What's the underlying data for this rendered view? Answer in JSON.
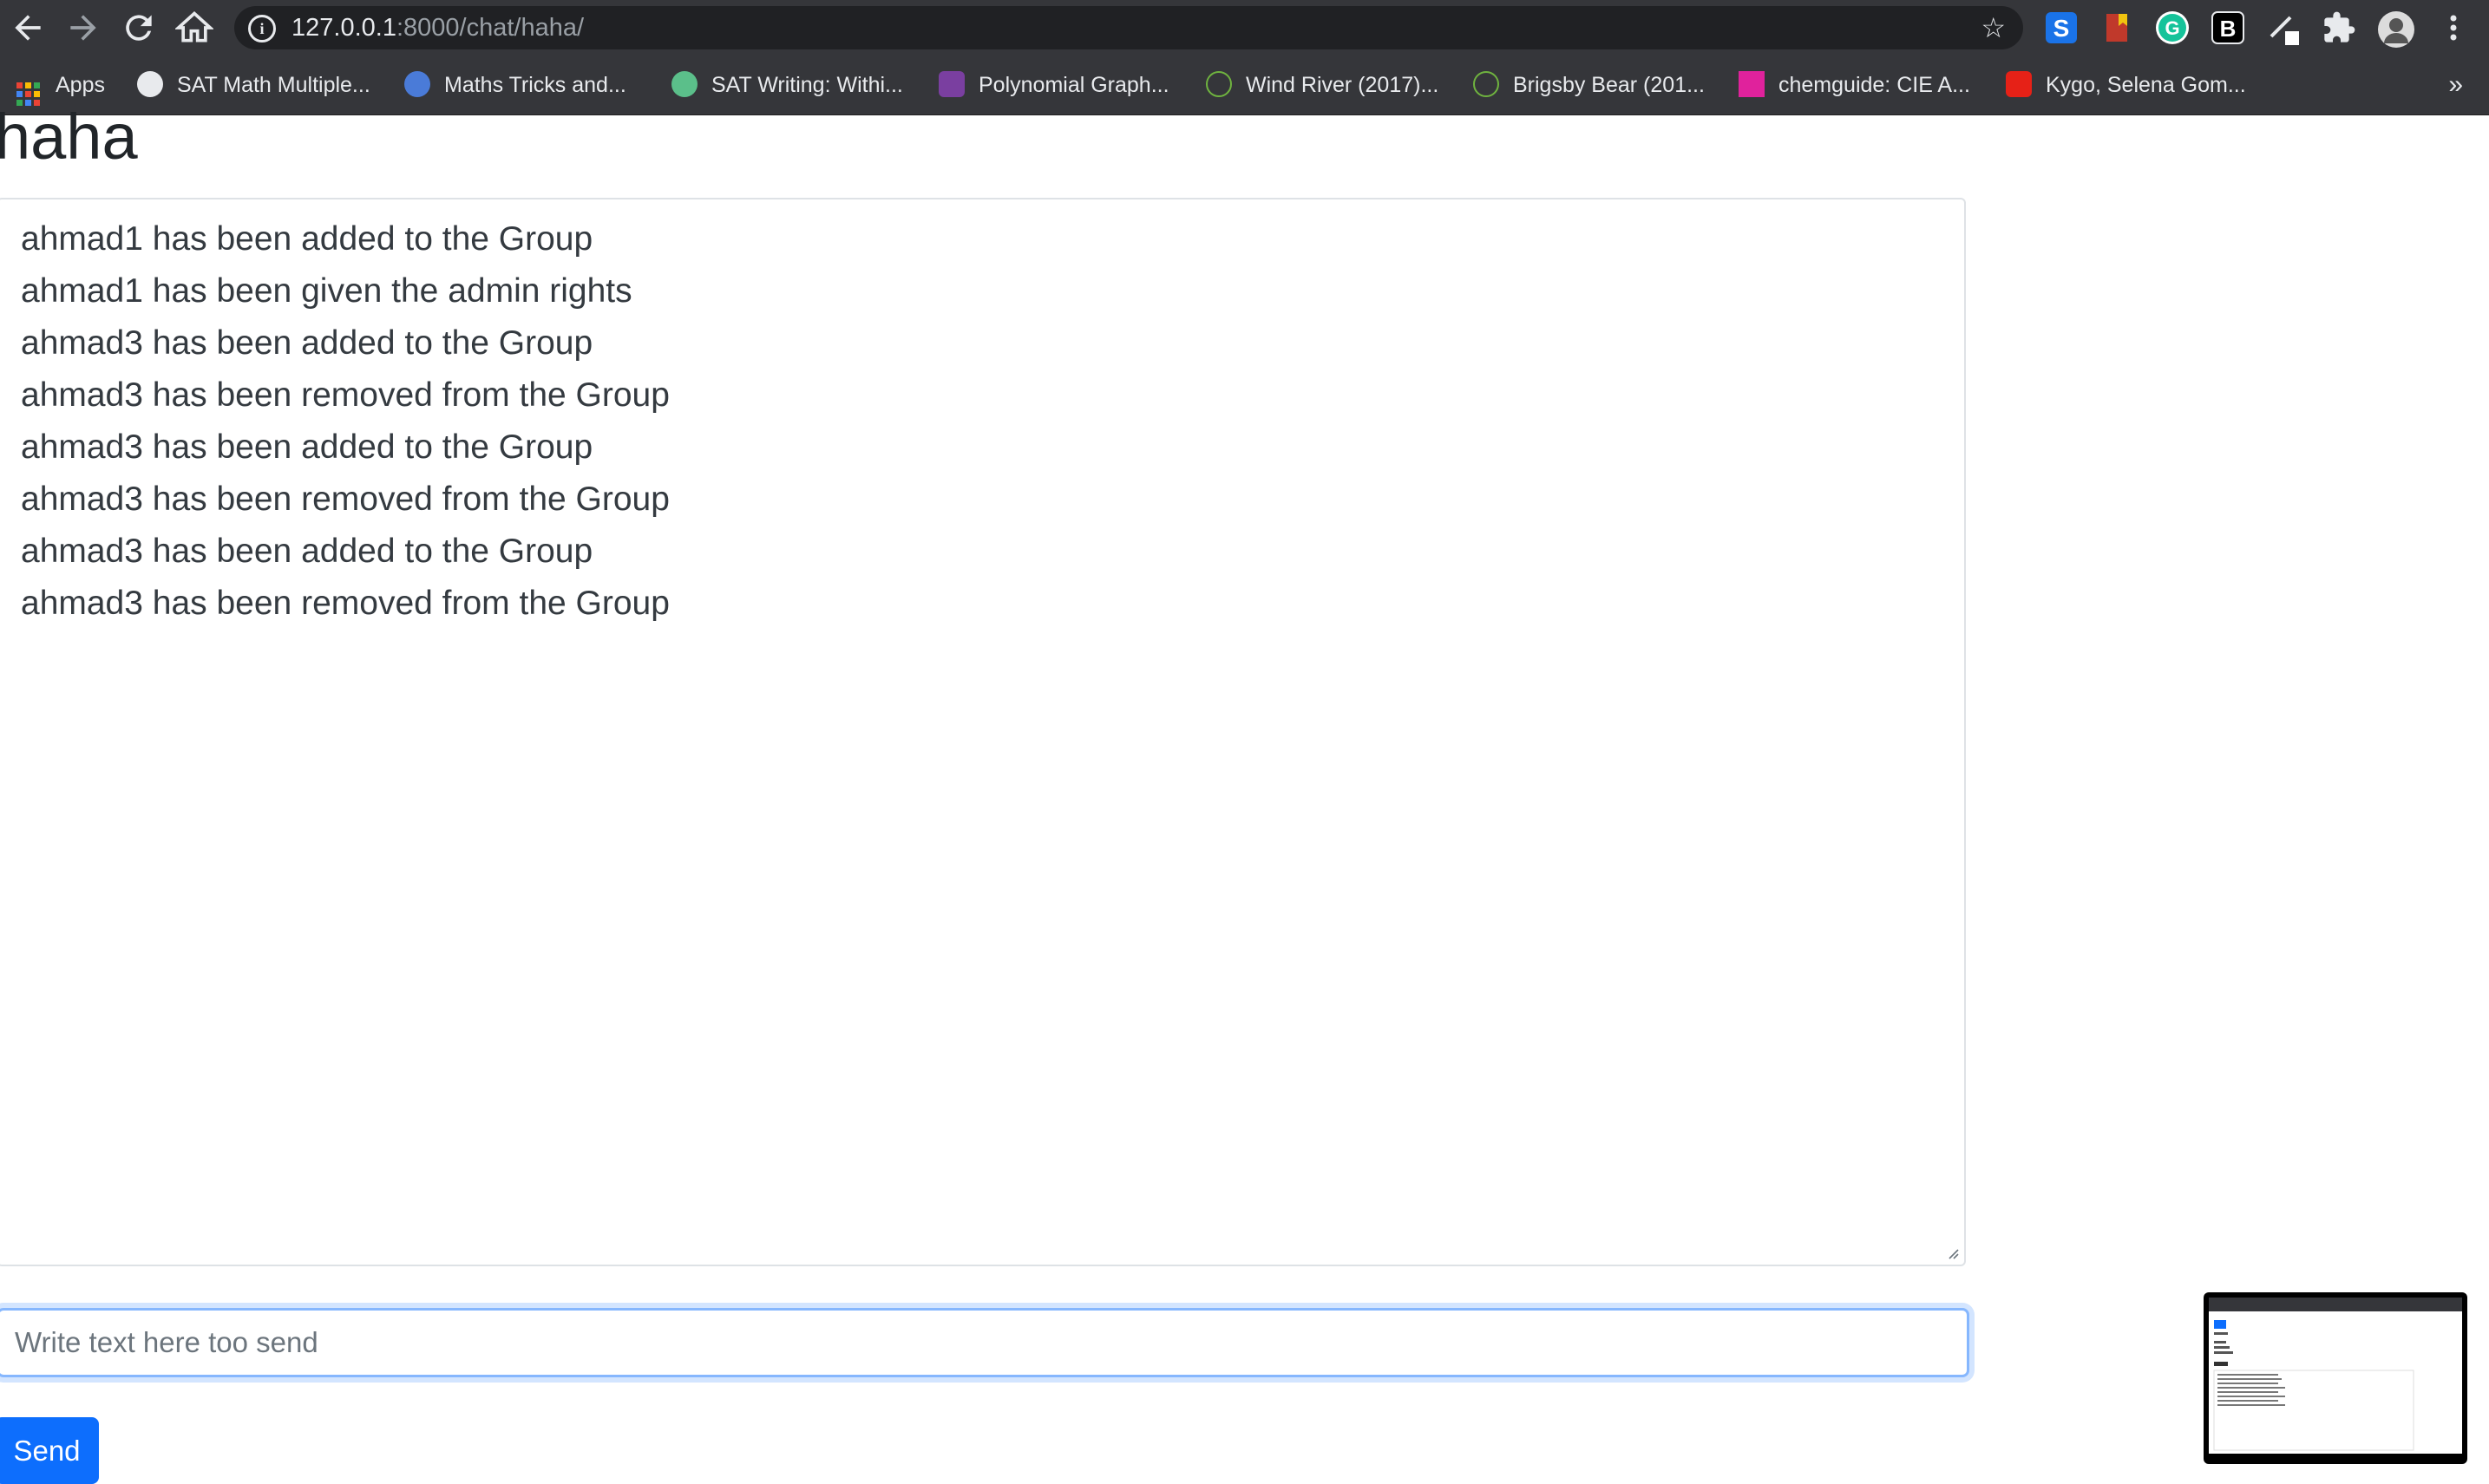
{
  "browser": {
    "url_host": "127.0.0.1",
    "url_rest": ":8000/chat/haha/",
    "bookmarks": [
      {
        "label": "Apps",
        "icon": "apps-grid-icon",
        "color": "#ea4335"
      },
      {
        "label": "SAT Math Multiple...",
        "icon": "globe-icon",
        "color": "#e8eaed"
      },
      {
        "label": "Maths Tricks and...",
        "icon": "site-logo-icon",
        "color": "#4a7bd8"
      },
      {
        "label": "SAT Writing: Withi...",
        "icon": "leaf-icon",
        "color": "#5bbf8a"
      },
      {
        "label": "Polynomial Graph...",
        "icon": "desmos-icon",
        "color": "#7a3fa0"
      },
      {
        "label": "Wind River (2017)...",
        "icon": "yts-icon",
        "color": "#6fb33f"
      },
      {
        "label": "Brigsby Bear (201...",
        "icon": "yts-icon",
        "color": "#6fb33f"
      },
      {
        "label": "chemguide: CIE A...",
        "icon": "chemguide-icon",
        "color": "#e0229c"
      },
      {
        "label": "Kygo, Selena Gom...",
        "icon": "youtube-icon",
        "color": "#e62117"
      }
    ],
    "extensions": [
      {
        "icon": "s-extension-icon",
        "color": "#5ba4e6"
      },
      {
        "icon": "bookmark-extension-icon",
        "color": "#c0392b"
      },
      {
        "icon": "grammarly-icon",
        "color": "#15c39a"
      },
      {
        "icon": "b-extension-icon",
        "color": "#000000"
      },
      {
        "icon": "pen-extension-icon",
        "color": "#e8eaed"
      },
      {
        "icon": "puzzle-icon",
        "color": "#e8eaed"
      },
      {
        "icon": "profile-avatar-icon",
        "color": "#9aa0a6"
      },
      {
        "icon": "menu-dots-icon",
        "color": "#e8eaed"
      }
    ],
    "more_bookmarks_label": "»"
  },
  "page": {
    "title": "haha",
    "log": [
      "ahmad1 has been added to the Group",
      "ahmad1 has been given the admin rights",
      "ahmad3 has been added to the Group",
      "ahmad3 has been removed from the Group",
      "ahmad3 has been added to the Group",
      "ahmad3 has been removed from the Group",
      "ahmad3 has been added to the Group",
      "ahmad3 has been removed from the Group"
    ],
    "input_placeholder": "Write text here too send",
    "send_label": "Send"
  },
  "colors": {
    "accent": "#0d6efd",
    "chrome": "#35363a",
    "omnibox": "#202124"
  }
}
